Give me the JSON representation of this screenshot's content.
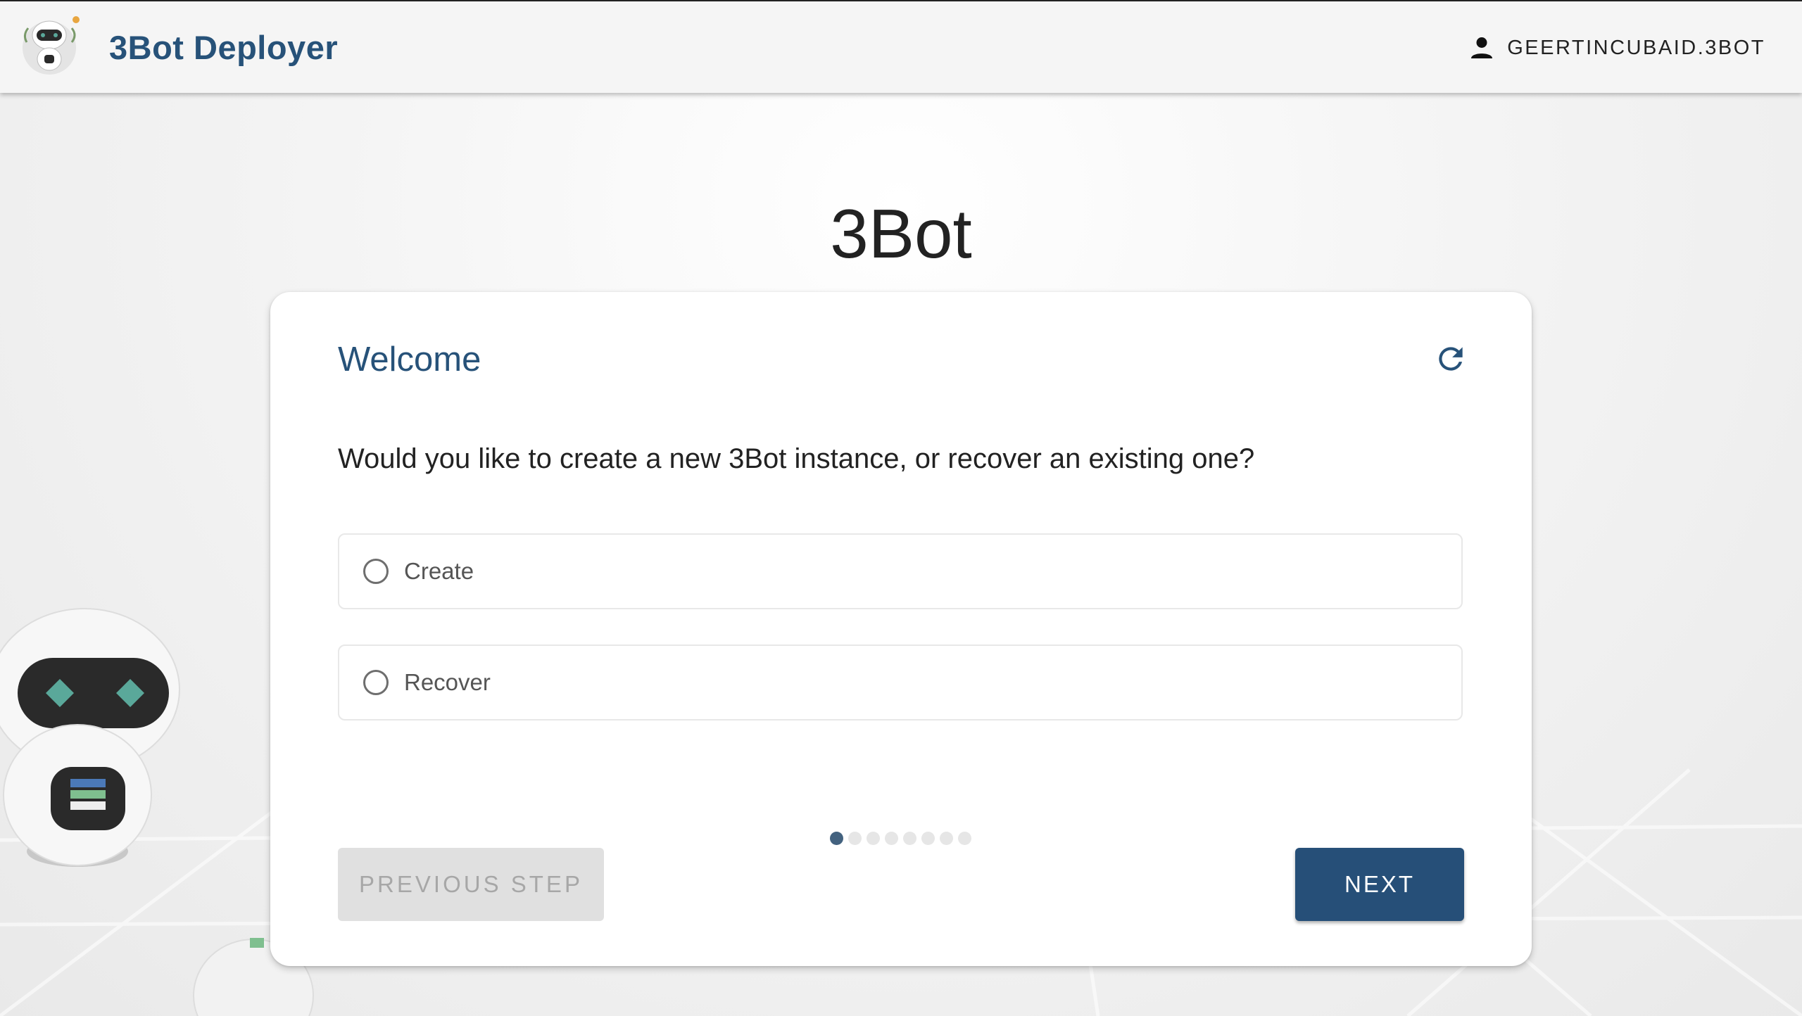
{
  "header": {
    "app_title": "3Bot Deployer",
    "logo_icon": "robot-logo-icon",
    "user_icon": "person-icon",
    "username": "GEERTINCUBAID.3BOT"
  },
  "page": {
    "title": "3Bot"
  },
  "wizard": {
    "step_title": "Welcome",
    "refresh_icon": "refresh-icon",
    "question": "Would you like to create a new 3Bot instance, or recover an existing one?",
    "options": [
      {
        "label": "Create",
        "selected": false
      },
      {
        "label": "Recover",
        "selected": false
      }
    ],
    "steps_total": 8,
    "current_step": 1,
    "previous_label": "PREVIOUS STEP",
    "previous_disabled": true,
    "next_label": "NEXT"
  },
  "colors": {
    "brand": "#275279",
    "button_primary": "#264f78",
    "button_disabled": "#e0e0e0",
    "step_active": "#43627f",
    "step_inactive": "#e6e6e6"
  }
}
